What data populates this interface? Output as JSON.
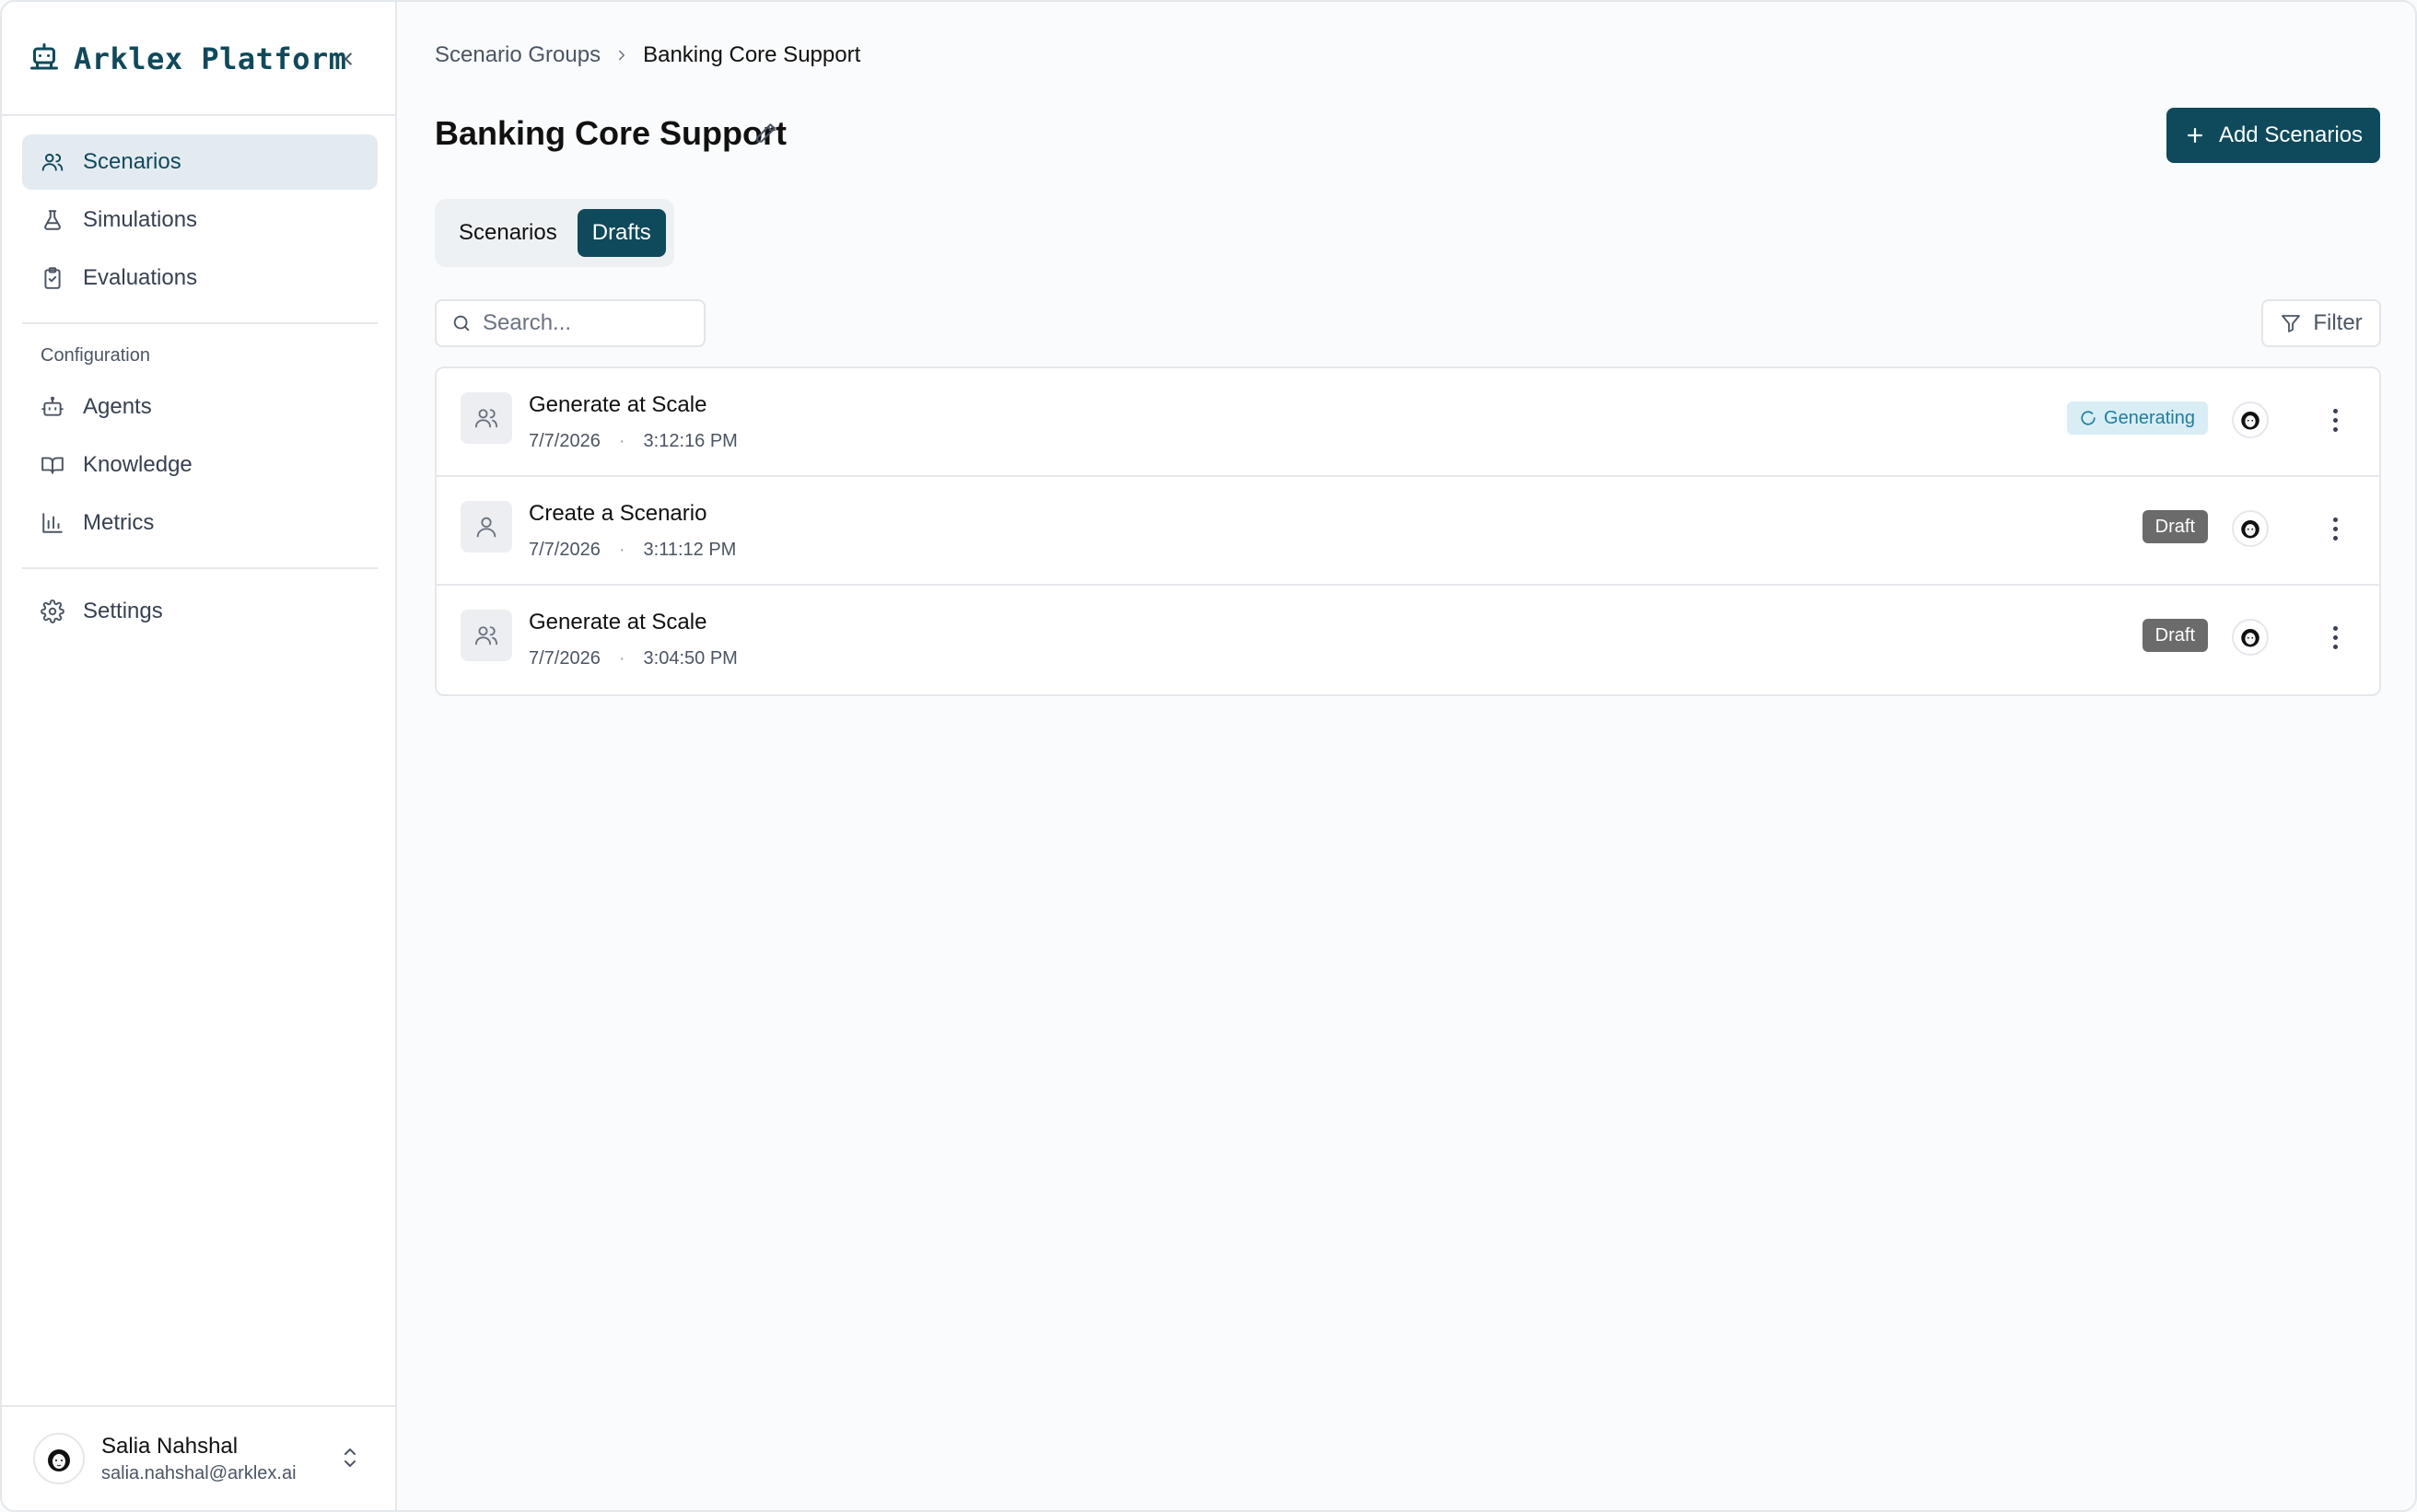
{
  "app": {
    "title": "Arklex Platform"
  },
  "sidebar": {
    "items": [
      {
        "label": "Scenarios",
        "icon": "users-icon",
        "active": true
      },
      {
        "label": "Simulations",
        "icon": "flask-icon",
        "active": false
      },
      {
        "label": "Evaluations",
        "icon": "clipboard-check-icon",
        "active": false
      }
    ],
    "config_label": "Configuration",
    "config_items": [
      {
        "label": "Agents",
        "icon": "bot-icon"
      },
      {
        "label": "Knowledge",
        "icon": "book-icon"
      },
      {
        "label": "Metrics",
        "icon": "bar-chart-icon"
      }
    ],
    "settings_label": "Settings"
  },
  "user": {
    "name": "Salia Nahshal",
    "email": "salia.nahshal@arklex.ai"
  },
  "breadcrumb": {
    "parent": "Scenario Groups",
    "current": "Banking Core Support"
  },
  "page": {
    "title": "Banking Core Support",
    "add_button": "Add Scenarios"
  },
  "tabs": [
    {
      "label": "Scenarios",
      "active": false
    },
    {
      "label": "Drafts",
      "active": true
    }
  ],
  "search": {
    "placeholder": "Search...",
    "value": ""
  },
  "filter": {
    "label": "Filter"
  },
  "rows": [
    {
      "title": "Generate at Scale",
      "date": "7/7/2026",
      "time": "3:12:16 PM",
      "status": "Generating",
      "icon": "users-icon"
    },
    {
      "title": "Create a Scenario",
      "date": "7/7/2026",
      "time": "3:11:12 PM",
      "status": "Draft",
      "icon": "user-icon"
    },
    {
      "title": "Generate at Scale",
      "date": "7/7/2026",
      "time": "3:04:50 PM",
      "status": "Draft",
      "icon": "users-icon"
    }
  ],
  "colors": {
    "brand": "#0e4a5c",
    "active_nav_bg": "#e4ebf0",
    "generating_bg": "#d9edf5",
    "generating_text": "#1c7ea0",
    "draft_bg": "#6b6b6b"
  }
}
